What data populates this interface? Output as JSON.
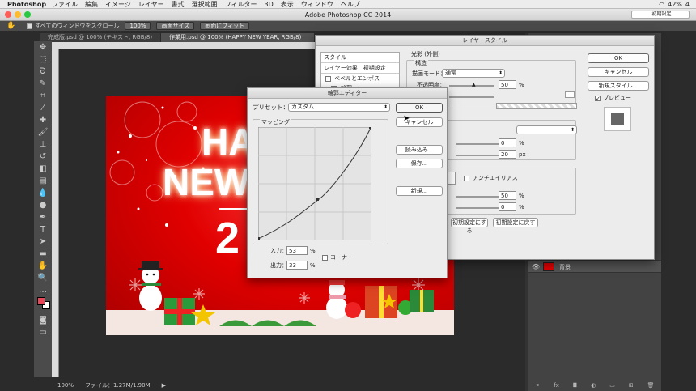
{
  "menubar": {
    "app": "Photoshop",
    "items": [
      "ファイル",
      "編集",
      "イメージ",
      "レイヤー",
      "書式",
      "選択範囲",
      "フィルター",
      "3D",
      "表示",
      "ウィンドウ",
      "ヘルプ"
    ],
    "battery": "42%",
    "clock": "4"
  },
  "window": {
    "title": "Adobe Photoshop CC 2014",
    "workspace": "初期設定"
  },
  "options": {
    "scroll_all_label": "すべてのウィンドウをスクロール",
    "zoom_label": "100%",
    "fit_screen": "画面サイズ",
    "fill_screen": "画面にフィット"
  },
  "tabs": [
    {
      "label": "完成版.psd @ 100% (テキスト, RGB/8)"
    },
    {
      "label": "作業用.psd @ 100% (HAPPY NEW YEAR, RGB/8) *"
    }
  ],
  "status": {
    "zoom": "100%",
    "file": "ファイル：1.27M/1.90M"
  },
  "canvas": {
    "text_line1": "HA",
    "text_line2": "NEW",
    "text_year": "2"
  },
  "layer": {
    "name": "背景"
  },
  "layer_style": {
    "title": "レイヤースタイル",
    "styles_header": "スタイル",
    "blend_options": "レイヤー効果：初期設定",
    "bevel": "ベベルとエンボス",
    "contour": "輪郭",
    "section_outer_glow": "光彩 (外側)",
    "structure": "構造",
    "blend_mode_label": "描画モード：",
    "blend_mode_value": "通常",
    "opacity_label": "不透明度：",
    "opacity_value": "50",
    "percent": "%",
    "px": "px",
    "elements_value1": "0",
    "elements_value2": "20",
    "antialias": "アンチエイリアス",
    "quality_value1": "50",
    "quality_value2": "0",
    "reset_default": "初期設定にする",
    "restore_default": "初期設定に戻す",
    "ok": "OK",
    "cancel": "キャンセル",
    "new_style": "新規スタイル...",
    "preview": "プレビュー"
  },
  "contour_editor": {
    "title": "輪郭エディター",
    "preset_label": "プリセット：",
    "preset_value": "カスタム",
    "mapping": "マッピング",
    "input_label": "入力：",
    "input_value": "53",
    "output_label": "出力：",
    "output_value": "33",
    "percent": "%",
    "corner": "コーナー",
    "ok": "OK",
    "cancel": "キャンセル",
    "load": "読み込み...",
    "save": "保存...",
    "new": "新規..."
  },
  "colors": {
    "foreground": "#e8475a",
    "background": "#ffffff",
    "accent": "#e10000"
  }
}
